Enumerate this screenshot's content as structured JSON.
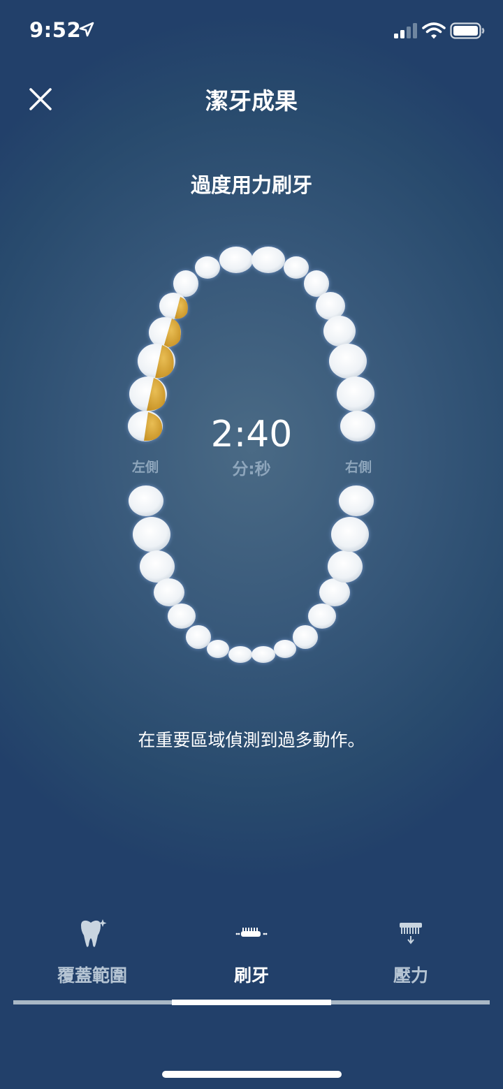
{
  "status_bar": {
    "time": "9:52"
  },
  "header": {
    "title": "潔牙成果"
  },
  "section": {
    "title": "過度用力刷牙"
  },
  "timer": {
    "value": "2:40",
    "unit": "分:秒"
  },
  "sides": {
    "left": "左側",
    "right": "右側"
  },
  "message": "在重要區域偵測到過多動作。",
  "tabs": [
    {
      "label": "覆蓋範圍",
      "icon": "tooth-sparkle-icon",
      "active": false
    },
    {
      "label": "刷牙",
      "icon": "brushing-icon",
      "active": true
    },
    {
      "label": "壓力",
      "icon": "pressure-icon",
      "active": false
    }
  ],
  "colors": {
    "background": "#2f5175",
    "highlight_tooth": "#d8a93a",
    "tooth": "#f4f7fa",
    "muted_text": "#8ea6bc"
  }
}
